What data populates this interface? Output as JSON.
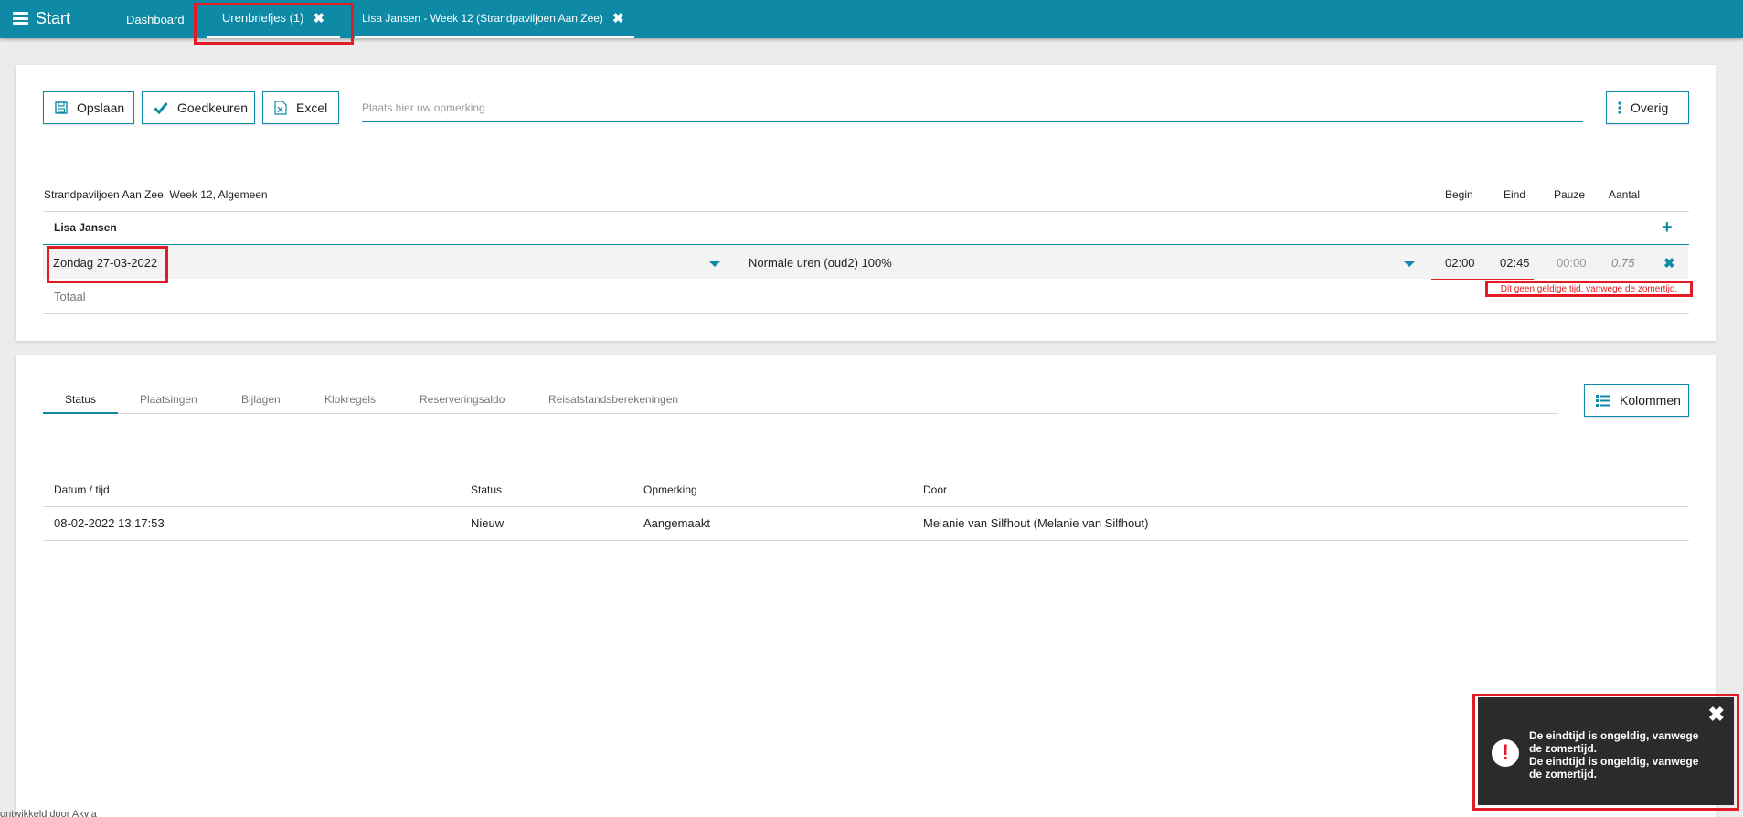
{
  "topbar": {
    "start_label": "Start",
    "tabs": [
      {
        "label": "Dashboard"
      },
      {
        "label": "Urenbriefjes (1)"
      },
      {
        "label": "Lisa Jansen - Week 12 (Strandpaviljoen Aan Zee)"
      }
    ]
  },
  "toolbar": {
    "save_label": "Opslaan",
    "approve_label": "Goedkeuren",
    "excel_label": "Excel",
    "remark_placeholder": "Plaats hier uw opmerking",
    "more_label": "Overig"
  },
  "timesheet": {
    "title": "Strandpaviljoen Aan Zee, Week 12, Algemeen",
    "columns": {
      "begin": "Begin",
      "end": "Eind",
      "pause": "Pauze",
      "amount": "Aantal"
    },
    "employee": "Lisa Jansen",
    "row": {
      "date": "Zondag 27-03-2022",
      "hour_type": "Normale uren (oud2) 100%",
      "begin": "02:00",
      "end": "02:45",
      "pause": "00:00",
      "amount": "0.75"
    },
    "total_label": "Totaal",
    "error_text": "Dit geen geldige tijd, vanwege de zomertijd."
  },
  "details": {
    "tabs": [
      "Status",
      "Plaatsingen",
      "Bijlagen",
      "Klokregels",
      "Reserveringsaldo",
      "Reisafstandsberekeningen"
    ],
    "columns_button": "Kolommen",
    "table": {
      "headers": [
        "Datum / tijd",
        "Status",
        "Opmerking",
        "Door"
      ],
      "rows": [
        [
          "08-02-2022 13:17:53",
          "Nieuw",
          "Aangemaakt",
          "Melanie van Silfhout (Melanie van Silfhout)"
        ]
      ]
    }
  },
  "toast": {
    "line1": "De eindtijd is ongeldig, vanwege de zomertijd.",
    "line2": "De eindtijd is ongeldig, vanwege de zomertijd."
  },
  "footer": "ontwikkeld door Akyla",
  "colors": {
    "accent": "#0e8aa6",
    "error": "#e21b24"
  }
}
